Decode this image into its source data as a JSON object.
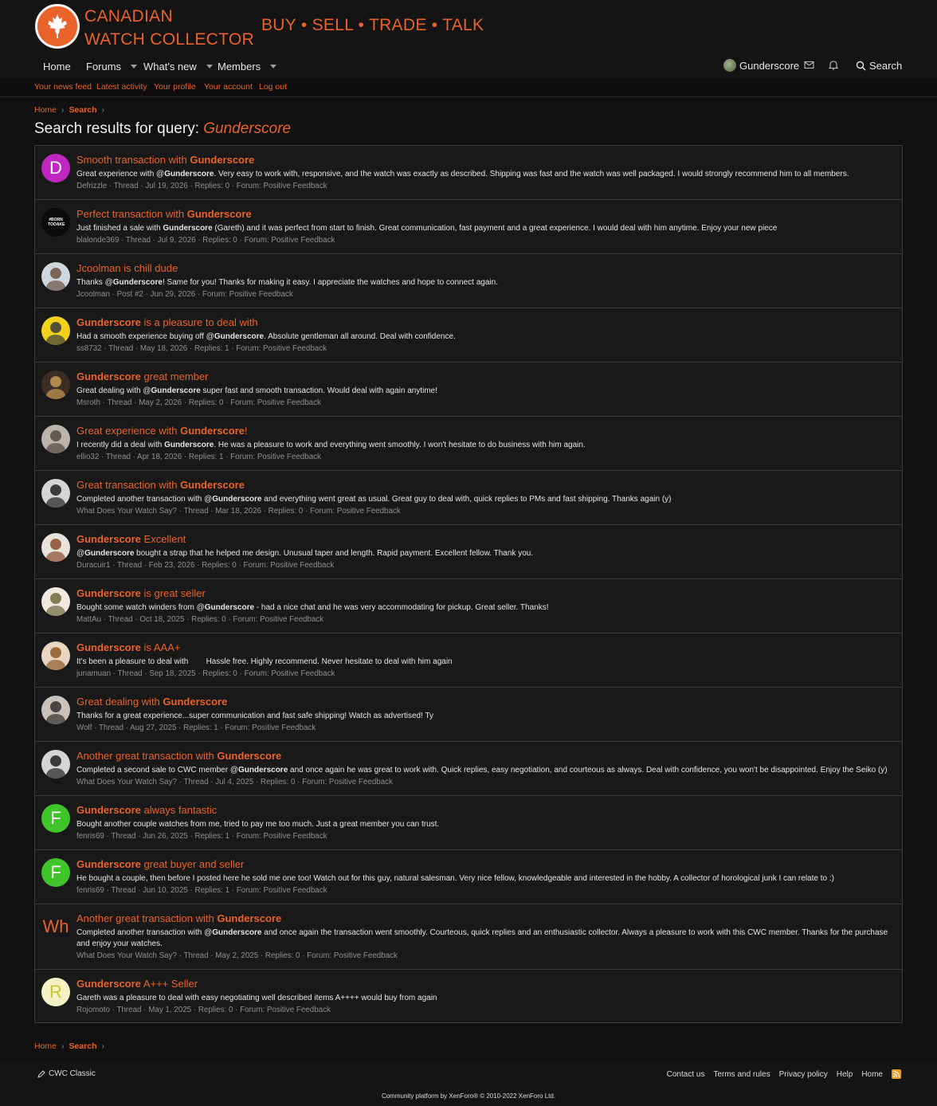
{
  "brand": {
    "line1": "CANADIAN",
    "line2": "WATCH COLLECTOR",
    "tagline": "BUY • SELL • TRADE • TALK"
  },
  "nav": {
    "items": [
      {
        "label": "Home",
        "has_menu": false
      },
      {
        "label": "Forums",
        "has_menu": true
      },
      {
        "label": "What's new",
        "has_menu": true
      },
      {
        "label": "Members",
        "has_menu": true
      }
    ],
    "username": "Gunderscore",
    "search_label": "Search"
  },
  "subnav": [
    "Your news feed",
    "Latest activity",
    "Your profile",
    "Your account",
    "Log out"
  ],
  "breadcrumb": {
    "home": "Home",
    "search": "Search"
  },
  "page": {
    "title_prefix": "Search results for query:",
    "query": "Gunderscore"
  },
  "results": [
    {
      "avatar": {
        "type": "letter",
        "letter": "D",
        "bg": "#c026c0",
        "fg": "#ffffff"
      },
      "title_pre": "Smooth transaction with ",
      "title_strong": "Gunderscore",
      "title_post": "",
      "snippet_pre": "Great experience with @",
      "snippet_strong": "Gunderscore",
      "snippet_post": ". Very easy to work with, responsive, and the watch was exactly as described. Shipping was fast and the watch was well packaged. I would strongly recommend him to all members.",
      "meta": "Defrizzle · Thread · Jul 19, 2026 · Replies: 0 · Forum: Positive Feedback"
    },
    {
      "avatar": {
        "type": "text",
        "text": "#BORN TOOAKE",
        "bg": "#0b0b0b",
        "fg": "#ffffff"
      },
      "title_pre": "Perfect transaction with ",
      "title_strong": "Gunderscore",
      "title_post": "",
      "snippet_pre": "Just finished a sale with ",
      "snippet_strong": "Gunderscore",
      "snippet_post": " (Gareth) and it was perfect from start to finish. Great communication, fast payment and a great experience. I would deal with him anytime. Enjoy your new piece",
      "meta": "blalonde369 · Thread · Jul 9, 2026 · Replies: 0 · Forum: Positive Feedback"
    },
    {
      "avatar": {
        "type": "photo",
        "bg": "#cfd6de",
        "fg": "#6a5040"
      },
      "title_pre": "Jcoolman is chill dude",
      "title_strong": "",
      "title_post": "",
      "snippet_pre": "Thanks @",
      "snippet_strong": "Gunderscore",
      "snippet_post": "! Same for you! Thanks for making it easy. I appreciate the watches and hope to connect again.",
      "meta": "Jcoolman · Post #2 · Jun 29, 2026 · Forum: Positive Feedback"
    },
    {
      "avatar": {
        "type": "photo",
        "bg": "#f2d21a",
        "fg": "#3a3a3a"
      },
      "title_pre": "",
      "title_strong": "Gunderscore",
      "title_post": " is a pleasure to deal with",
      "snippet_pre": "Had a smooth experience buying off @",
      "snippet_strong": "Gunderscore",
      "snippet_post": ". Absolute gentleman all around. Deal with confidence.",
      "meta": "ss8732 · Thread · May 18, 2026 · Replies: 1 · Forum: Positive Feedback"
    },
    {
      "avatar": {
        "type": "photo",
        "bg": "#3c2e22",
        "fg": "#c79a54"
      },
      "title_pre": "",
      "title_strong": "Gunderscore",
      "title_post": " great member",
      "snippet_pre": "Great dealing with @",
      "snippet_strong": "Gunderscore",
      "snippet_post": " super fast and smooth transaction. Would deal with again anytime!",
      "meta": "Msroth · Thread · May 2, 2026 · Replies: 0 · Forum: Positive Feedback"
    },
    {
      "avatar": {
        "type": "photo",
        "bg": "#b9b4ad",
        "fg": "#514942"
      },
      "title_pre": "Great experience with ",
      "title_strong": "Gunderscore",
      "title_post": "!",
      "snippet_pre": "I recently did a deal with ",
      "snippet_strong": "Gunderscore",
      "snippet_post": ". He was a pleasure to work and everything went smoothly. I won't hesitate to do business with him again.",
      "meta": "ellio32 · Thread · Apr 18, 2026 · Replies: 1 · Forum: Positive Feedback"
    },
    {
      "avatar": {
        "type": "photo",
        "bg": "#d5d5d5",
        "fg": "#202020"
      },
      "title_pre": "Great transaction with ",
      "title_strong": "Gunderscore",
      "title_post": "",
      "snippet_pre": "Completed another transaction with @",
      "snippet_strong": "Gunderscore",
      "snippet_post": " and everything went great as usual. Great guy to deal with, quick replies to PMs and fast shipping. Thanks again (y)",
      "meta": "What Does Your Watch Say? · Thread · Mar 18, 2026 · Replies: 0 · Forum: Positive Feedback"
    },
    {
      "avatar": {
        "type": "photo",
        "bg": "#e7e2dc",
        "fg": "#8a4b2b"
      },
      "title_pre": "",
      "title_strong": "Gunderscore",
      "title_post": " Excellent",
      "snippet_pre": "@",
      "snippet_strong": "Gunderscore",
      "snippet_post": " bought a strap that he helped me design. Unusual taper and length. Rapid payment. Excellent fellow. Thank you.",
      "meta": "Duracuir1 · Thread · Feb 23, 2026 · Replies: 0 · Forum: Positive Feedback"
    },
    {
      "avatar": {
        "type": "photo",
        "bg": "#eeeae0",
        "fg": "#6b6a3a"
      },
      "title_pre": "",
      "title_strong": "Gunderscore",
      "title_post": " is great seller",
      "snippet_pre": "Bought some watch winders from @",
      "snippet_strong": "Gunderscore",
      "snippet_post": " - had a nice chat and he was very accommodating for pickup. Great seller. Thanks!",
      "meta": "MattAu · Thread · Oct 18, 2025 · Replies: 0 · Forum: Positive Feedback"
    },
    {
      "avatar": {
        "type": "photo",
        "bg": "#e9d6c2",
        "fg": "#8b5a2b"
      },
      "title_pre": "",
      "title_strong": "Gunderscore",
      "title_post": " is AAA+",
      "snippet_pre": "It's been a pleasure to deal with",
      "snippet_strong": "",
      "snippet_post": "        Hassle free. Highly recommend. Never hesitate to deal with him again",
      "meta": "junamuan · Thread · Sep 18, 2025 · Replies: 0 · Forum: Positive Feedback"
    },
    {
      "avatar": {
        "type": "photo",
        "bg": "#c8c2bb",
        "fg": "#303030"
      },
      "title_pre": "Great dealing with ",
      "title_strong": "Gunderscore",
      "title_post": "",
      "snippet_pre": "Thanks for a great experience...super communication and fast safe shipping! Watch as advertised! Ty",
      "snippet_strong": "",
      "snippet_post": "",
      "meta": "Wolf · Thread · Aug 27, 2025 · Replies: 1 · Forum: Positive Feedback"
    },
    {
      "avatar": {
        "type": "photo",
        "bg": "#d5d5d5",
        "fg": "#202020"
      },
      "title_pre": "Another great transaction with ",
      "title_strong": "Gunderscore",
      "title_post": "",
      "snippet_pre": "Completed a second sale to CWC member @",
      "snippet_strong": "Gunderscore",
      "snippet_post": " and once again he was great to work with. Quick replies, easy negotiation, and courteous as always. Deal with confidence, you won't be disappointed. Enjoy the Seiko (y)",
      "meta": "What Does Your Watch Say? · Thread · Jul 4, 2025 · Replies: 0 · Forum: Positive Feedback"
    },
    {
      "avatar": {
        "type": "letter",
        "letter": "F",
        "bg": "#3fc52a",
        "fg": "#ffffff"
      },
      "title_pre": "",
      "title_strong": "Gunderscore",
      "title_post": " always fantastic",
      "snippet_pre": "Bought another couple watches from me, tried to pay me too much. Just a great member you can trust.",
      "snippet_strong": "",
      "snippet_post": "",
      "meta": "fenris69 · Thread · Jun 26, 2025 · Replies: 1 · Forum: Positive Feedback"
    },
    {
      "avatar": {
        "type": "letter",
        "letter": "F",
        "bg": "#3fc52a",
        "fg": "#ffffff"
      },
      "title_pre": "",
      "title_strong": "Gunderscore",
      "title_post": " great buyer and seller",
      "snippet_pre": "He bought a couple, then before I posted here he sold me one too! Watch out for this guy, natural salesman. Very nice fellow, knowledgeable and interested in the hobby. A collector of horological junk I can relate to :)",
      "snippet_strong": "",
      "snippet_post": "",
      "meta": "fenris69 · Thread · Jun 10, 2025 · Replies: 1 · Forum: Positive Feedback"
    },
    {
      "avatar": {
        "type": "letter",
        "letter": "Wh",
        "bg": "#191919",
        "fg": "#e8622a"
      },
      "title_pre": "Another great transaction with ",
      "title_strong": "Gunderscore",
      "title_post": "",
      "snippet_pre": "Completed another transaction with @",
      "snippet_strong": "Gunderscore",
      "snippet_post": " and once again the transaction went smoothly. Courteous, quick replies and an enthusiastic collector. Always a pleasure to work with this CWC member. Thanks for the purchase and enjoy your watches.",
      "meta": "What Does Your Watch Say? · Thread · May 2, 2025 · Replies: 0 · Forum: Positive Feedback"
    },
    {
      "avatar": {
        "type": "letter",
        "letter": "R",
        "bg": "#f4f2c4",
        "fg": "#c8c430"
      },
      "title_pre": "",
      "title_strong": "Gunderscore",
      "title_post": " A+++ Seller",
      "snippet_pre": "Gareth was a pleasure to deal with easy negotiating well described items A++++ would buy from again",
      "snippet_strong": "",
      "snippet_post": "",
      "meta": "Rojomoto · Thread · May 1, 2025 · Replies: 0 · Forum: Positive Feedback"
    }
  ],
  "footer": {
    "style_label": "CWC Classic",
    "links": [
      "Contact us",
      "Terms and rules",
      "Privacy policy",
      "Help",
      "Home"
    ],
    "copyright": "Community platform by XenForo® © 2010-2022 XenForo Ltd."
  },
  "colors": {
    "accent": "#e8622a",
    "background": "#111111",
    "panel": "#191919",
    "border": "#3a3a3a",
    "meta": "#8f8f8f"
  }
}
